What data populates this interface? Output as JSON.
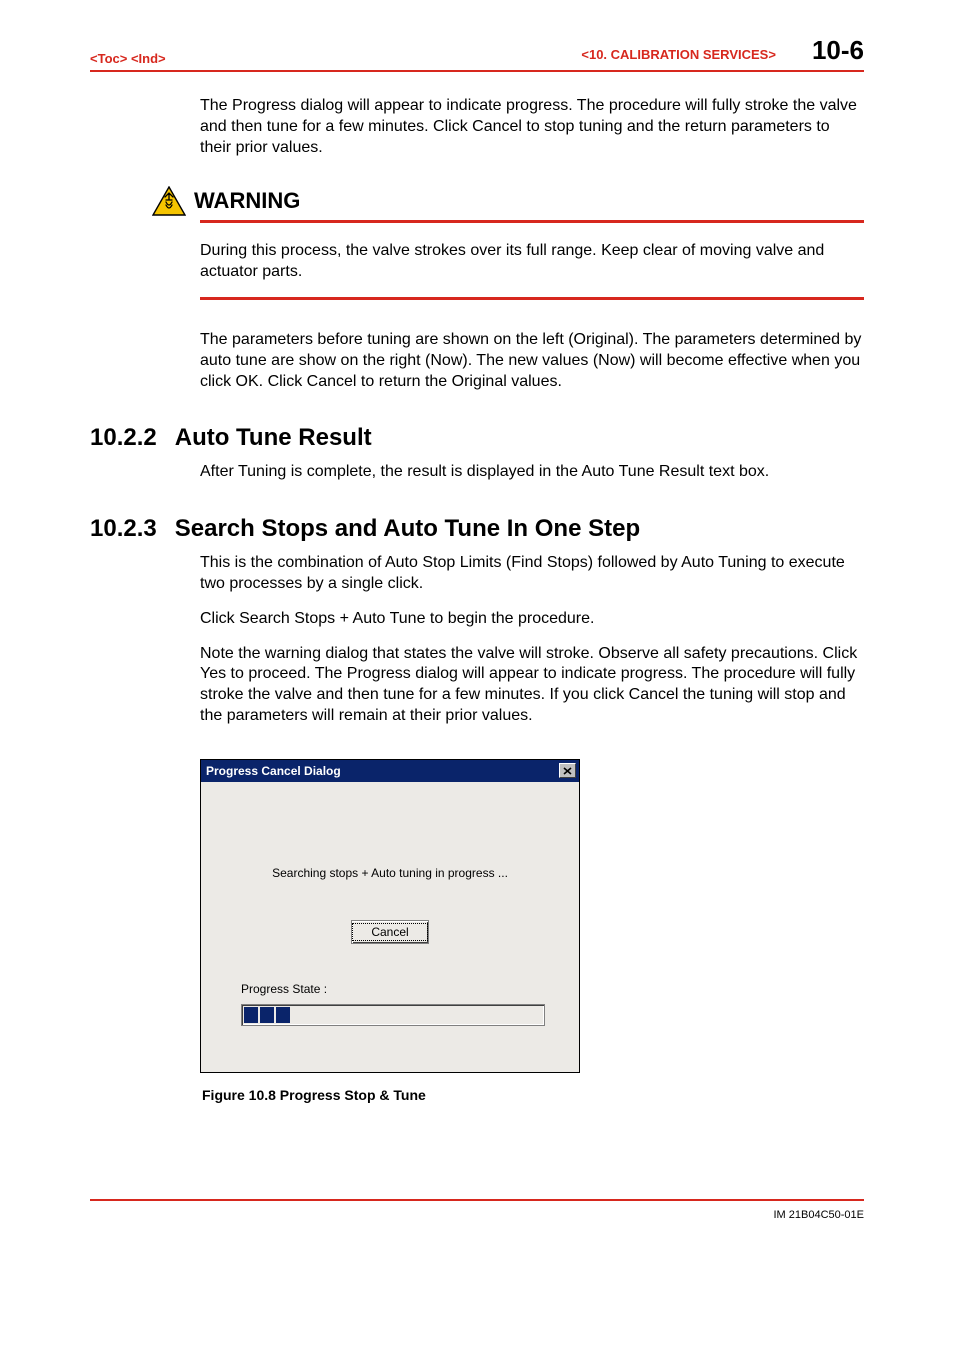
{
  "header": {
    "toc": "<Toc>",
    "ind": "<Ind>",
    "section": "<10.  CALIBRATION SERVICES>",
    "page": "10-6"
  },
  "para_intro": "The Progress dialog will appear to indicate progress.  The procedure will fully stroke the valve and then tune for a few minutes.  Click Cancel to stop tuning and the return parameters to their prior values.",
  "warning": {
    "title": "WARNING",
    "body": "During this process, the valve strokes over its full range.  Keep clear of moving valve and actuator parts."
  },
  "para_after_warn": "The parameters before tuning are shown on the left (Original).  The parameters determined by auto tune are show on the right (Now).  The new values (Now) will become effective when you click OK.  Click Cancel to return the Original values.",
  "sec1": {
    "num": "10.2.2",
    "title": "Auto Tune Result",
    "body": "After Tuning is complete, the result is displayed in the Auto Tune Result text box."
  },
  "sec2": {
    "num": "10.2.3",
    "title": "Search Stops and Auto Tune In One Step",
    "p1": "This is the combination of Auto Stop Limits (Find Stops) followed by Auto Tuning to execute two processes by a single click.",
    "p2": "Click Search Stops + Auto Tune to begin the procedure.",
    "p3": "Note the warning dialog that states the valve will stroke.  Observe all safety precautions.  Click Yes to proceed.  The Progress dialog will appear to indicate progress.  The procedure will fully stroke the valve and then tune for a few minutes.  If you click Cancel the tuning will stop and the parameters will remain at their prior values."
  },
  "dialog": {
    "title": "Progress Cancel Dialog",
    "message": "Searching stops + Auto tuning in progress ...",
    "cancel": "Cancel",
    "state_label": "Progress State :",
    "segments": 3
  },
  "figure_caption": "Figure 10.8 Progress Stop & Tune",
  "doc_id": "IM 21B04C50-01E"
}
